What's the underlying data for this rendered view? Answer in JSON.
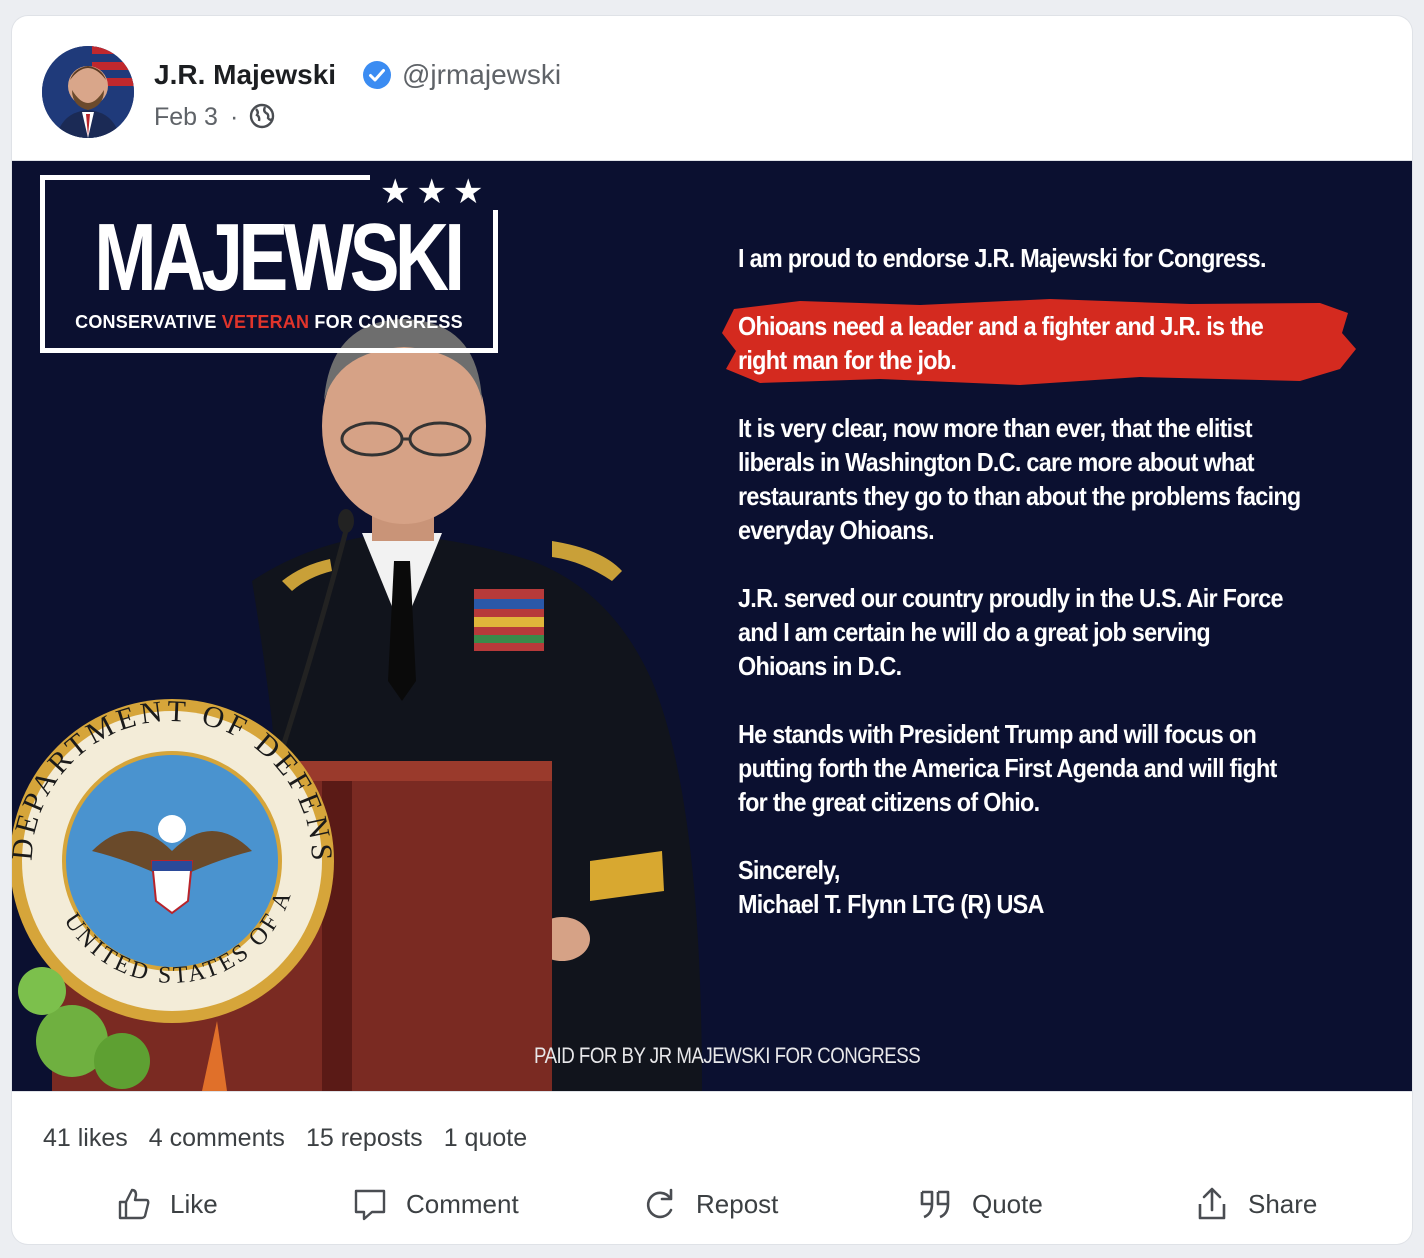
{
  "post": {
    "author_name": "J.R. Majewski",
    "author_handle": "@jrmajewski",
    "date": "Feb 3",
    "separator": "·",
    "visibility_icon": "globe-icon",
    "verified_icon": "verified-badge-icon"
  },
  "image": {
    "logo_name": "MAJEWSKI",
    "logo_stars": "★★★",
    "logo_tag_1": "CONSERVATIVE ",
    "logo_tag_2": "VETERAN",
    "logo_tag_3": " FOR CONGRESS",
    "letter": {
      "p1": "I am proud to endorse J.R. Majewski for Congress.",
      "p2a": "Ohioans need a leader and a fighter and J.R. is the",
      "p2b": "right man for the job.",
      "p3a": "It is very clear, now more than ever, that the elitist",
      "p3b": "liberals in Washington D.C. care more about what",
      "p3c": "restaurants they go to than about the problems facing",
      "p3d": "everyday Ohioans.",
      "p4a": "J.R. served our country proudly in the U.S. Air Force",
      "p4b": "and I am certain he will do a great job serving",
      "p4c": "Ohioans in D.C.",
      "p5a": "He stands with President Trump and will focus on",
      "p5b": "putting forth the America First Agenda and will fight",
      "p5c": "for the great citizens of Ohio.",
      "p6a": "Sincerely,",
      "p6b": "Michael T. Flynn LTG (R) USA"
    },
    "seal_text_top": "DEPARTMENT OF DEFENSE",
    "seal_text_bottom": "UNITED STATES OF AMERICA",
    "paid_for": "PAID FOR BY JR MAJEWSKI FOR CONGRESS",
    "highlight_color": "#d42a1f"
  },
  "stats": {
    "likes": "41 likes",
    "comments": "4 comments",
    "reposts": "15 reposts",
    "quotes": "1 quote"
  },
  "actions": {
    "like": "Like",
    "comment": "Comment",
    "repost": "Repost",
    "quote": "Quote",
    "share": "Share"
  }
}
